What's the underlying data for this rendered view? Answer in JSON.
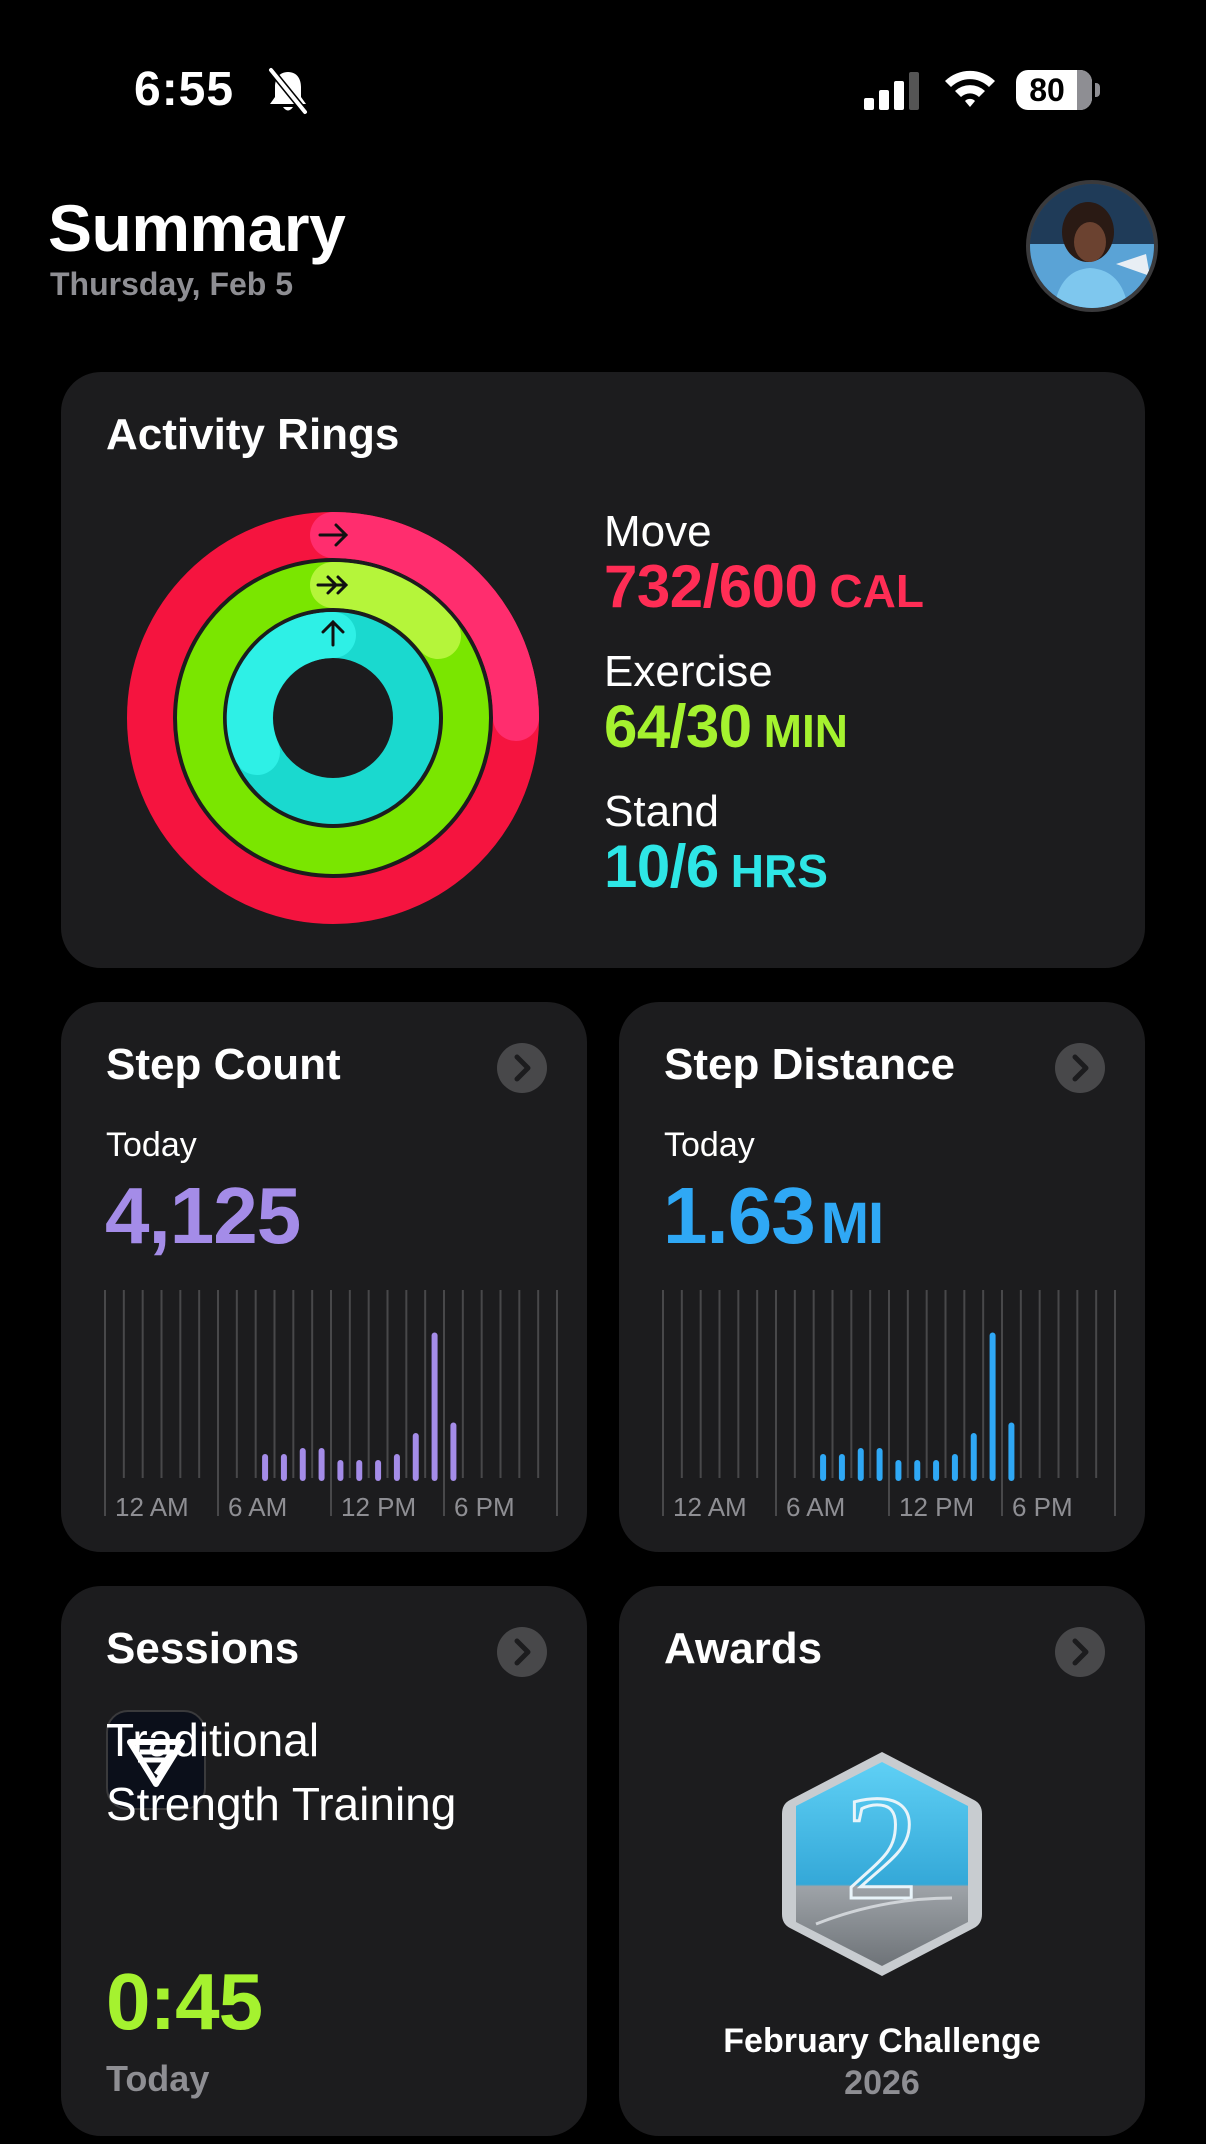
{
  "status_bar": {
    "time": "6:55",
    "battery": "80",
    "battery_level": 0.8,
    "icons": [
      "bell-slash-icon",
      "cellular-signal-icon",
      "wifi-icon",
      "battery-icon"
    ]
  },
  "header": {
    "title": "Summary",
    "date": "Thursday, Feb 5"
  },
  "activity_rings": {
    "title": "Activity Rings",
    "move": {
      "label": "Move",
      "value": "732/600",
      "unit": "CAL",
      "color": "#ff2d55",
      "progress": 1.22
    },
    "exercise": {
      "label": "Exercise",
      "value": "64/30",
      "unit": "MIN",
      "color": "#a5f22f",
      "progress": 2.13
    },
    "stand": {
      "label": "Stand",
      "value": "10/6",
      "unit": "HRS",
      "color": "#2ee6e6",
      "progress": 1.67
    }
  },
  "step_count": {
    "title": "Step Count",
    "period": "Today",
    "value": "4,125",
    "color": "#a48ce8",
    "axis_labels": [
      "12 AM",
      "6 AM",
      "12 PM",
      "6 PM"
    ]
  },
  "step_distance": {
    "title": "Step Distance",
    "period": "Today",
    "value": "1.63",
    "unit": "MI",
    "color": "#2fa8f5",
    "axis_labels": [
      "12 AM",
      "6 AM",
      "12 PM",
      "6 PM"
    ]
  },
  "sessions": {
    "title": "Sessions",
    "icon": "strength-training-app-icon",
    "name_line1": "Traditional",
    "name_line2": "Strength Training",
    "duration": "0:45",
    "period": "Today"
  },
  "awards": {
    "title": "Awards",
    "badge": "2026-award-badge-icon",
    "name": "February Challenge",
    "year": "2026"
  },
  "hourly_bars": {
    "relative_heights": [
      0,
      0,
      0,
      0,
      0,
      0,
      0,
      0,
      0.14,
      0.14,
      0.18,
      0.18,
      0.1,
      0.1,
      0.1,
      0.14,
      0.28,
      0.95,
      0.35,
      0,
      0,
      0,
      0,
      0
    ]
  }
}
